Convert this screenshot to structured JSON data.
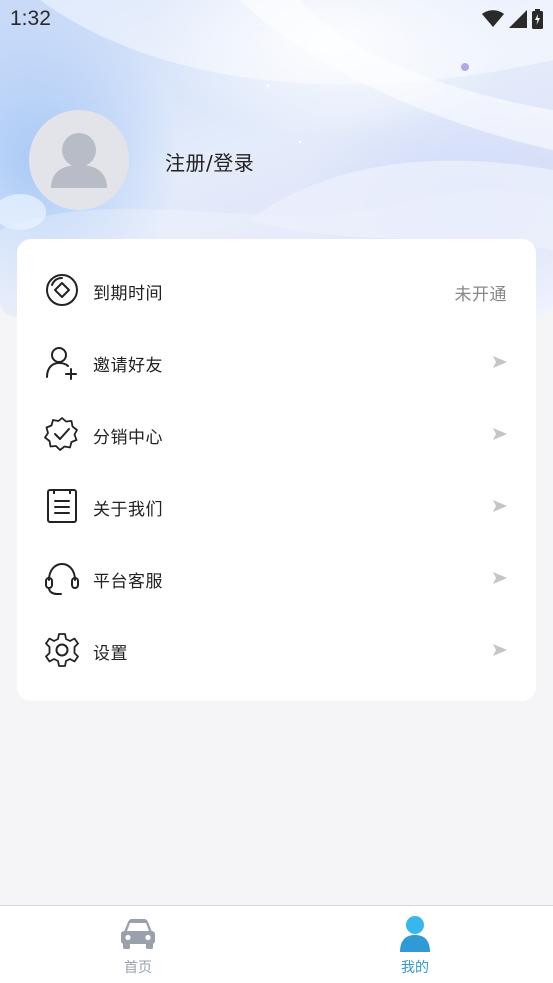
{
  "status_bar": {
    "time": "1:32",
    "icons": [
      "wifi-icon",
      "signal-icon",
      "battery-charging-icon"
    ]
  },
  "profile": {
    "avatar_icon": "default-avatar-icon",
    "login_label": "注册/登录"
  },
  "menu": {
    "items": [
      {
        "label": "到期时间",
        "icon": "expiry-time-icon",
        "value": "未开通",
        "trailing": "value"
      },
      {
        "label": "邀请好友",
        "icon": "invite-user-icon",
        "trailing": "arrow"
      },
      {
        "label": "分销中心",
        "icon": "badge-check-icon",
        "trailing": "arrow"
      },
      {
        "label": "关于我们",
        "icon": "document-list-icon",
        "trailing": "arrow"
      },
      {
        "label": "平台客服",
        "icon": "headset-icon",
        "trailing": "arrow"
      },
      {
        "label": "设置",
        "icon": "gear-icon",
        "trailing": "arrow"
      }
    ],
    "arrow_icon": "arrow-right-icon"
  },
  "tab_bar": {
    "tabs": [
      {
        "label": "首页",
        "icon": "car-icon",
        "active": false
      },
      {
        "label": "我的",
        "icon": "user-icon",
        "active": true
      }
    ]
  },
  "colors": {
    "active_tab": "#2f9ad6",
    "inactive_tab": "#9aa0ac",
    "page_background": "#f5f5f8",
    "card_background": "#ffffff"
  }
}
